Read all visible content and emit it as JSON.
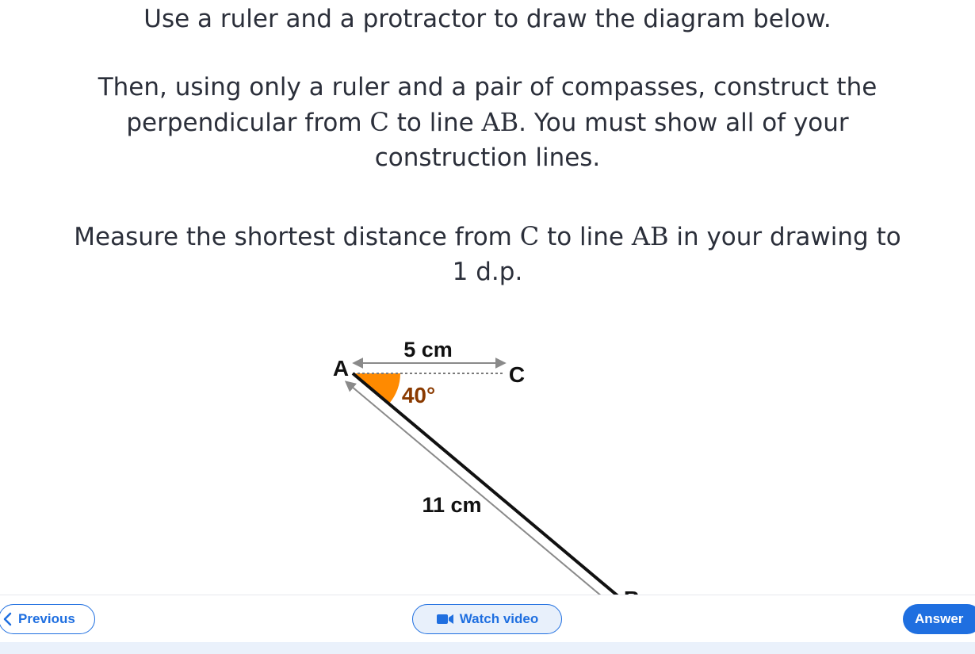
{
  "question": {
    "line1": "Use a ruler and a protractor to draw the diagram below.",
    "line2": "Then, using only a ruler and a pair of compasses, construct the",
    "line3_a": "perpendicular from ",
    "line3_b": "C",
    "line3_c": " to line ",
    "line3_d": "AB",
    "line3_e": ". You must show all of your",
    "line4": "construction lines.",
    "line5_a": "Measure the shortest distance from ",
    "line5_b": "C",
    "line5_c": " to line ",
    "line5_d": "AB",
    "line5_e": " in your drawing to",
    "line6": "1 d.p."
  },
  "diagram": {
    "label_a": "A",
    "label_c": "C",
    "label_b": "B",
    "length_ac": "5 cm",
    "length_ab": "11 cm",
    "angle": "40°",
    "colors": {
      "angle_fill": "#ff8a00",
      "angle_text": "#8a3a00",
      "line": "#111111",
      "measure": "#8a8a8a"
    }
  },
  "footer": {
    "previous_label": "Previous",
    "watch_video_label": "Watch video",
    "answer_label": "Answer",
    "accent": "#1f6fe0"
  }
}
